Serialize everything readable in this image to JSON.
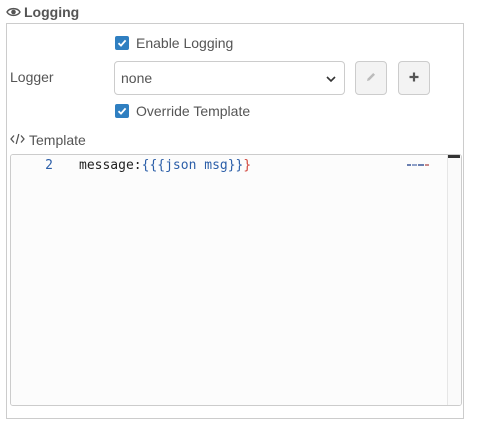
{
  "section": {
    "title": "Logging",
    "icon": "eye-icon"
  },
  "enable_logging": {
    "label": "Enable Logging",
    "checked": true
  },
  "logger": {
    "label": "Logger",
    "selected": "none",
    "edit_icon": "pencil-icon",
    "add_icon": "plus-icon"
  },
  "override_template": {
    "label": "Override Template",
    "checked": true
  },
  "template": {
    "label": "Template",
    "icon": "code-icon",
    "line_number": "2",
    "code_key": "message:",
    "code_open": "{{{",
    "code_expr": "json msg",
    "code_close_blue": "}}",
    "code_close_red": "}"
  },
  "colors": {
    "checkbox": "#2f7fc1",
    "border": "#cccccc",
    "text": "#555555"
  }
}
